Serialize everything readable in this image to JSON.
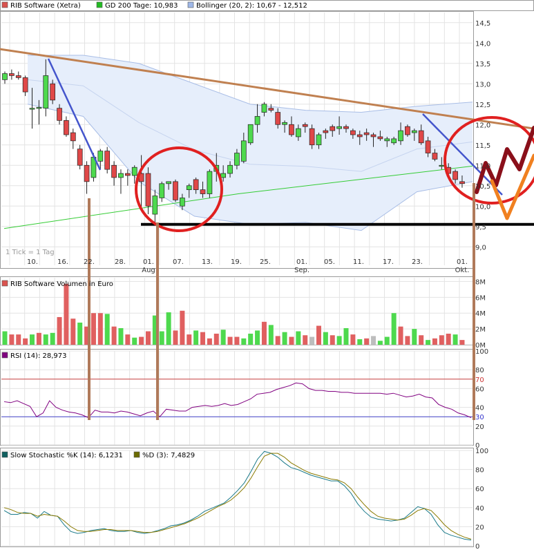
{
  "chart_data": [
    {
      "type": "candlestick",
      "panel": "price",
      "legend": [
        {
          "label": "RIB Software (Xetra)",
          "color": "#d9534f"
        },
        {
          "label": "GD 200 Tage: 10,983",
          "color": "#22bb22"
        },
        {
          "label": "Bollinger (20, 2): 10,67 - 12,512",
          "color": "#9fb8e8"
        }
      ],
      "note": "1 Tick = 1 Tag",
      "yticks": [
        "14,5",
        "14,0",
        "13,5",
        "13,0",
        "12,5",
        "12,0",
        "11,5",
        "11,0",
        "10,5",
        "10,0",
        "9,5",
        "9,0"
      ],
      "ylim": [
        8.75,
        14.75
      ],
      "xticks": [
        "10.",
        "16.",
        "22.",
        "28.",
        "01.",
        "07.",
        "13.",
        "19.",
        "25.",
        "01.",
        "05.",
        "11.",
        "17.",
        "23.",
        "01."
      ],
      "month_labels": [
        "Aug",
        "Sep.",
        "Okt."
      ],
      "grid": true,
      "candles": [
        {
          "o": 13.1,
          "h": 13.3,
          "l": 13.0,
          "c": 13.25
        },
        {
          "o": 13.25,
          "h": 13.35,
          "l": 13.1,
          "c": 13.2
        },
        {
          "o": 13.2,
          "h": 13.3,
          "l": 13.1,
          "c": 13.15
        },
        {
          "o": 13.15,
          "h": 13.2,
          "l": 12.7,
          "c": 12.8
        },
        {
          "o": 12.4,
          "h": 12.9,
          "l": 11.9,
          "c": 12.4
        },
        {
          "o": 12.4,
          "h": 12.6,
          "l": 12.0,
          "c": 12.42
        },
        {
          "o": 12.4,
          "h": 13.6,
          "l": 12.2,
          "c": 13.2
        },
        {
          "o": 13.0,
          "h": 13.1,
          "l": 12.5,
          "c": 12.6
        },
        {
          "o": 12.4,
          "h": 12.5,
          "l": 12.0,
          "c": 12.1
        },
        {
          "o": 12.1,
          "h": 12.2,
          "l": 11.7,
          "c": 11.75
        },
        {
          "o": 11.8,
          "h": 11.9,
          "l": 11.4,
          "c": 11.6
        },
        {
          "o": 11.4,
          "h": 11.5,
          "l": 10.9,
          "c": 11.0
        },
        {
          "o": 11.0,
          "h": 11.1,
          "l": 10.3,
          "c": 10.6
        },
        {
          "o": 10.7,
          "h": 11.3,
          "l": 10.6,
          "c": 11.2
        },
        {
          "o": 11.1,
          "h": 11.4,
          "l": 10.9,
          "c": 11.35
        },
        {
          "o": 11.35,
          "h": 11.45,
          "l": 10.8,
          "c": 10.9
        },
        {
          "o": 11.0,
          "h": 11.1,
          "l": 10.5,
          "c": 10.7
        },
        {
          "o": 10.7,
          "h": 10.9,
          "l": 10.3,
          "c": 10.8
        },
        {
          "o": 10.8,
          "h": 10.9,
          "l": 10.5,
          "c": 10.75
        },
        {
          "o": 10.75,
          "h": 11.0,
          "l": 10.55,
          "c": 10.95
        },
        {
          "o": 10.8,
          "h": 11.25,
          "l": 9.95,
          "c": 10.6
        },
        {
          "o": 10.8,
          "h": 10.95,
          "l": 9.8,
          "c": 10.0
        },
        {
          "o": 9.8,
          "h": 10.4,
          "l": 9.6,
          "c": 10.25
        },
        {
          "o": 10.2,
          "h": 10.6,
          "l": 10.1,
          "c": 10.55
        },
        {
          "o": 10.55,
          "h": 10.6,
          "l": 10.4,
          "c": 10.6
        },
        {
          "o": 10.6,
          "h": 10.65,
          "l": 10.1,
          "c": 10.15
        },
        {
          "o": 10.0,
          "h": 10.3,
          "l": 9.9,
          "c": 10.2
        },
        {
          "o": 10.4,
          "h": 10.55,
          "l": 10.2,
          "c": 10.5
        },
        {
          "o": 10.65,
          "h": 10.7,
          "l": 10.3,
          "c": 10.4
        },
        {
          "o": 10.4,
          "h": 10.6,
          "l": 10.2,
          "c": 10.3
        },
        {
          "o": 10.3,
          "h": 10.9,
          "l": 10.2,
          "c": 10.85
        },
        {
          "o": 10.85,
          "h": 11.3,
          "l": 10.6,
          "c": 11.0
        },
        {
          "o": 10.7,
          "h": 11.0,
          "l": 10.6,
          "c": 10.8
        },
        {
          "o": 10.8,
          "h": 11.1,
          "l": 10.7,
          "c": 11.0
        },
        {
          "o": 11.0,
          "h": 11.4,
          "l": 10.9,
          "c": 11.3
        },
        {
          "o": 11.1,
          "h": 11.8,
          "l": 11.05,
          "c": 11.6
        },
        {
          "o": 11.55,
          "h": 12.0,
          "l": 11.5,
          "c": 12.0
        },
        {
          "o": 12.0,
          "h": 12.5,
          "l": 11.8,
          "c": 12.2
        },
        {
          "o": 12.3,
          "h": 12.55,
          "l": 12.2,
          "c": 12.5
        },
        {
          "o": 12.4,
          "h": 12.5,
          "l": 12.3,
          "c": 12.35
        },
        {
          "o": 12.3,
          "h": 12.4,
          "l": 11.9,
          "c": 12.0
        },
        {
          "o": 12.0,
          "h": 12.1,
          "l": 11.8,
          "c": 12.05
        },
        {
          "o": 12.0,
          "h": 12.2,
          "l": 11.7,
          "c": 11.75
        },
        {
          "o": 11.7,
          "h": 12.0,
          "l": 11.6,
          "c": 11.9
        },
        {
          "o": 12.0,
          "h": 12.05,
          "l": 11.8,
          "c": 11.95
        },
        {
          "o": 11.9,
          "h": 12.0,
          "l": 11.4,
          "c": 11.5
        },
        {
          "o": 11.5,
          "h": 11.8,
          "l": 11.4,
          "c": 11.75
        },
        {
          "o": 11.85,
          "h": 11.9,
          "l": 11.65,
          "c": 11.8
        },
        {
          "o": 11.95,
          "h": 12.0,
          "l": 11.7,
          "c": 11.85
        },
        {
          "o": 11.9,
          "h": 12.2,
          "l": 11.75,
          "c": 11.95
        },
        {
          "o": 11.95,
          "h": 12.0,
          "l": 11.8,
          "c": 11.9
        },
        {
          "o": 11.85,
          "h": 11.9,
          "l": 11.65,
          "c": 11.75
        },
        {
          "o": 11.75,
          "h": 11.85,
          "l": 11.5,
          "c": 11.7
        },
        {
          "o": 11.8,
          "h": 11.9,
          "l": 11.6,
          "c": 11.75
        },
        {
          "o": 11.75,
          "h": 11.8,
          "l": 11.45,
          "c": 11.7
        },
        {
          "o": 11.7,
          "h": 11.85,
          "l": 11.6,
          "c": 11.65
        },
        {
          "o": 11.6,
          "h": 11.7,
          "l": 11.45,
          "c": 11.65
        },
        {
          "o": 11.55,
          "h": 11.7,
          "l": 11.5,
          "c": 11.65
        },
        {
          "o": 11.6,
          "h": 12.05,
          "l": 11.5,
          "c": 11.85
        },
        {
          "o": 11.95,
          "h": 12.0,
          "l": 11.7,
          "c": 11.75
        },
        {
          "o": 11.8,
          "h": 11.9,
          "l": 11.6,
          "c": 11.85
        },
        {
          "o": 11.85,
          "h": 12.0,
          "l": 11.5,
          "c": 11.55
        },
        {
          "o": 11.6,
          "h": 11.7,
          "l": 11.2,
          "c": 11.3
        },
        {
          "o": 11.3,
          "h": 11.4,
          "l": 11.1,
          "c": 11.15
        },
        {
          "o": 11.0,
          "h": 11.2,
          "l": 10.9,
          "c": 11.0
        },
        {
          "o": 10.95,
          "h": 11.05,
          "l": 10.75,
          "c": 10.8
        },
        {
          "o": 10.85,
          "h": 10.9,
          "l": 10.55,
          "c": 10.65
        },
        {
          "o": 10.6,
          "h": 10.75,
          "l": 10.45,
          "c": 10.55
        }
      ],
      "ma200": [
        9.45,
        10.3,
        10.98
      ],
      "bollinger_upper": [
        13.7,
        13.7,
        13.5,
        13.0,
        12.5,
        12.35,
        12.3,
        12.45,
        12.55
      ],
      "bollinger_lower": [
        12.5,
        12.2,
        10.6,
        9.75,
        9.55,
        9.6,
        9.4,
        10.35,
        10.6
      ],
      "annotations": {
        "support_level": 9.55,
        "resistance_start": 13.85,
        "resistance_end": 11.9
      }
    },
    {
      "type": "bar",
      "panel": "volume",
      "legend": [
        {
          "label": "RIB Software Volumen in Euro",
          "color": "#d9534f"
        }
      ],
      "yticks": [
        "8M",
        "6M",
        "4M",
        "2M",
        "0M"
      ],
      "ylim": [
        0,
        8.3
      ],
      "values": [
        1.7,
        1.3,
        1.3,
        0.8,
        1.3,
        1.5,
        1.3,
        1.5,
        3.5,
        7.7,
        3.3,
        2.8,
        2.3,
        4.0,
        4.0,
        3.9,
        2.3,
        2.1,
        1.3,
        0.9,
        1.0,
        1.7,
        3.7,
        1.7,
        4.1,
        1.8,
        4.3,
        1.3,
        1.8,
        1.6,
        0.8,
        1.4,
        1.9,
        1.0,
        1.0,
        0.8,
        1.4,
        1.8,
        2.9,
        2.5,
        1.1,
        1.6,
        1.0,
        1.7,
        1.2,
        1.0,
        2.4,
        1.6,
        1.2,
        1.1,
        2.1,
        1.3,
        0.7,
        0.8,
        1.1,
        0.5,
        1.0,
        4.0,
        2.3,
        1.1,
        2.0,
        1.2,
        0.6,
        0.8,
        1.2,
        1.4,
        1.3,
        0.6
      ],
      "colors": [
        "g",
        "r",
        "r",
        "r",
        "g",
        "r",
        "g",
        "g",
        "r",
        "r",
        "r",
        "g",
        "r",
        "r",
        "r",
        "g",
        "r",
        "g",
        "r",
        "g",
        "r",
        "r",
        "g",
        "g",
        "g",
        "r",
        "r",
        "r",
        "g",
        "r",
        "r",
        "r",
        "g",
        "r",
        "r",
        "g",
        "g",
        "g",
        "r",
        "g",
        "r",
        "g",
        "r",
        "g",
        "r",
        "gr",
        "r",
        "g",
        "r",
        "g",
        "g",
        "r",
        "g",
        "r",
        "gr",
        "g",
        "g",
        "g",
        "r",
        "r",
        "g",
        "r",
        "g",
        "r",
        "r",
        "r",
        "g",
        "r"
      ]
    },
    {
      "type": "line",
      "panel": "rsi",
      "legend": [
        {
          "label": "RSI (14): 28,973",
          "color": "#800080"
        }
      ],
      "yticks": [
        "100",
        "80",
        "70",
        "60",
        "40",
        "30",
        "20",
        "0"
      ],
      "highlight_ticks": {
        "70": "#cc3333",
        "30": "#3333cc"
      },
      "ylim": [
        0,
        100
      ],
      "values": [
        46,
        45,
        47,
        44,
        41,
        30,
        34,
        47,
        40,
        37,
        35,
        34,
        32,
        29,
        37,
        35,
        35,
        34,
        36,
        35,
        33,
        31,
        34,
        36,
        30,
        38,
        37,
        36,
        36,
        40,
        41,
        42,
        41,
        42,
        44,
        42,
        43,
        46,
        49,
        54,
        55,
        56,
        59,
        61,
        63,
        66,
        65,
        60,
        58,
        58,
        57,
        57,
        56,
        56,
        55,
        55,
        55,
        55,
        55,
        54,
        55,
        53,
        51,
        52,
        54,
        51,
        50,
        43,
        40,
        38,
        34,
        32,
        29
      ],
      "hlines": [
        70,
        30
      ]
    },
    {
      "type": "line",
      "panel": "stochastic",
      "legend": [
        {
          "label": "Slow Stochastic %K (14): 6,1231",
          "color": "#106060"
        },
        {
          "label": "%D (3): 7,4829",
          "color": "#6b6b00"
        }
      ],
      "yticks": [
        "100",
        "80",
        "60",
        "40",
        "20",
        "0"
      ],
      "ylim": [
        0,
        100
      ],
      "series": [
        {
          "values": [
            37,
            33,
            33,
            35,
            34,
            29,
            36,
            32,
            31,
            22,
            15,
            13,
            14,
            16,
            17,
            18,
            16,
            15,
            15,
            16,
            14,
            13,
            14,
            16,
            18,
            21,
            22,
            24,
            27,
            31,
            36,
            39,
            42,
            45,
            51,
            58,
            66,
            78,
            91,
            99,
            97,
            93,
            87,
            82,
            80,
            77,
            74,
            72,
            70,
            68,
            68,
            63,
            55,
            44,
            36,
            30,
            28,
            27,
            26,
            27,
            29,
            35,
            41,
            39,
            33,
            22,
            14,
            11,
            9,
            7,
            6
          ]
        },
        {
          "values": [
            40,
            38,
            35,
            34,
            34,
            31,
            33,
            32,
            31,
            26,
            20,
            16,
            15,
            15,
            16,
            17,
            17,
            16,
            16,
            16,
            15,
            14,
            14,
            15,
            17,
            19,
            21,
            23,
            26,
            29,
            33,
            37,
            41,
            44,
            48,
            54,
            61,
            71,
            83,
            94,
            97,
            97,
            93,
            87,
            83,
            79,
            76,
            74,
            72,
            70,
            69,
            66,
            60,
            51,
            43,
            36,
            31,
            29,
            28,
            27,
            28,
            32,
            37,
            39,
            37,
            30,
            22,
            16,
            12,
            9,
            7
          ]
        }
      ]
    }
  ]
}
